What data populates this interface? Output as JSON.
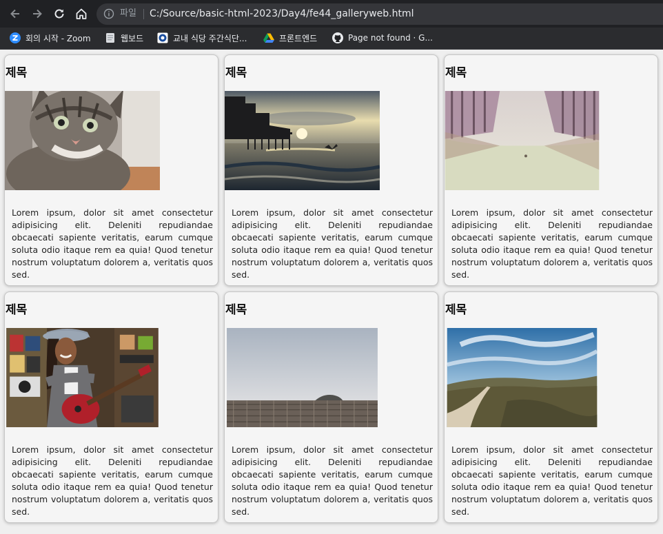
{
  "browser": {
    "scheme_label": "파일",
    "url": "C:/Source/basic-html-2023/Day4/fe44_galleryweb.html"
  },
  "bookmarks": [
    {
      "label": "회의 시작 - Zoom",
      "icon": "zoom-icon"
    },
    {
      "label": "웹보드",
      "icon": "page-icon"
    },
    {
      "label": "교내 식당 주간식단...",
      "icon": "school-icon"
    },
    {
      "label": "프론트엔드",
      "icon": "google-drive-icon"
    },
    {
      "label": "Page not found · G...",
      "icon": "github-icon"
    }
  ],
  "cards": [
    {
      "title": "제목",
      "image": "kitten-photo",
      "text": "Lorem ipsum, dolor sit amet consectetur adipisicing elit. Deleniti repudiandae obcaecati sapiente veritatis, earum cumque soluta odio itaque rem ea quia! Quod tenetur nostrum voluptatum dolorem a, veritatis quos sed."
    },
    {
      "title": "제목",
      "image": "pier-sunset-photo",
      "text": "Lorem ipsum, dolor sit amet consectetur adipisicing elit. Deleniti repudiandae obcaecati sapiente veritatis, earum cumque soluta odio itaque rem ea quia! Quod tenetur nostrum voluptatum dolorem a, veritatis quos sed."
    },
    {
      "title": "제목",
      "image": "forest-road-photo",
      "text": "Lorem ipsum, dolor sit amet consectetur adipisicing elit. Deleniti repudiandae obcaecati sapiente veritatis, earum cumque soluta odio itaque rem ea quia! Quod tenetur nostrum voluptatum dolorem a, veritatis quos sed."
    },
    {
      "title": "제목",
      "image": "guitar-player-photo",
      "text": "Lorem ipsum, dolor sit amet consectetur adipisicing elit. Deleniti repudiandae obcaecati sapiente veritatis, earum cumque soluta odio itaque rem ea quia! Quod tenetur nostrum voluptatum dolorem a, veritatis quos sed."
    },
    {
      "title": "제목",
      "image": "boardwalk-fog-photo",
      "text": "Lorem ipsum, dolor sit amet consectetur adipisicing elit. Deleniti repudiandae obcaecati sapiente veritatis, earum cumque soluta odio itaque rem ea quia! Quod tenetur nostrum voluptatum dolorem a, veritatis quos sed."
    },
    {
      "title": "제목",
      "image": "hill-path-photo",
      "text": "Lorem ipsum, dolor sit amet consectetur adipisicing elit. Deleniti repudiandae obcaecati sapiente veritatis, earum cumque soluta odio itaque rem ea quia! Quod tenetur nostrum voluptatum dolorem a, veritatis quos sed."
    }
  ]
}
